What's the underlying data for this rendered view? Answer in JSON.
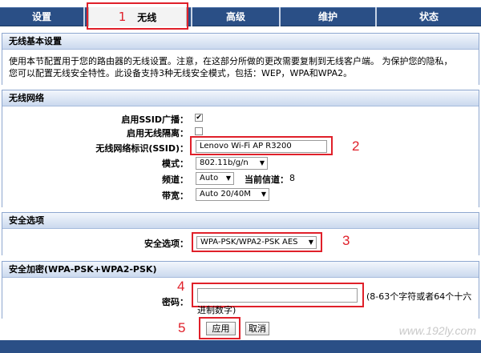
{
  "nav": {
    "tabs": [
      "设置",
      "无线",
      "高级",
      "维护",
      "状态"
    ],
    "active_number": "1"
  },
  "basic": {
    "title": "无线基本设置",
    "desc_line1": "使用本节配置用于您的路由器的无线设置。注意，在这部分所做的更改需要复制到无线客户端。 为保护您的隐私，",
    "desc_line2": "您可以配置无线安全特性。此设备支持3种无线安全模式，包括：WEP，WPA和WPA2。"
  },
  "wireless": {
    "title": "无线网络",
    "ssid_broadcast_label": "启用SSID广播：",
    "ssid_broadcast_checked": "✔",
    "isolation_label": "启用无线隔离：",
    "ssid_label": "无线网络标识(SSID)：",
    "ssid_value": "Lenovo Wi-Fi AP R3200",
    "mode_label": "模式：",
    "mode_value": "802.11b/g/n",
    "channel_label": "频道：",
    "channel_value": "Auto",
    "current_channel_label": "当前信道：",
    "current_channel_value": "8",
    "bandwidth_label": "带宽：",
    "bandwidth_value": "Auto 20/40M",
    "step": "2"
  },
  "security": {
    "title": "安全选项",
    "option_label": "安全选项：",
    "option_value": "WPA-PSK/WPA2-PSK AES",
    "step": "3"
  },
  "encryption": {
    "title": "安全加密(WPA-PSK+WPA2-PSK)",
    "password_label": "密码：",
    "password_value": "",
    "hint": "(8-63个字符或者64个十六",
    "hint2": "进制数字)",
    "step": "4"
  },
  "actions": {
    "apply_label": "应用",
    "cancel_label": "取消",
    "step": "5"
  },
  "watermark": "www.192ly.com",
  "colors": {
    "accent": "#e0202a",
    "nav": "#2a4f86"
  }
}
